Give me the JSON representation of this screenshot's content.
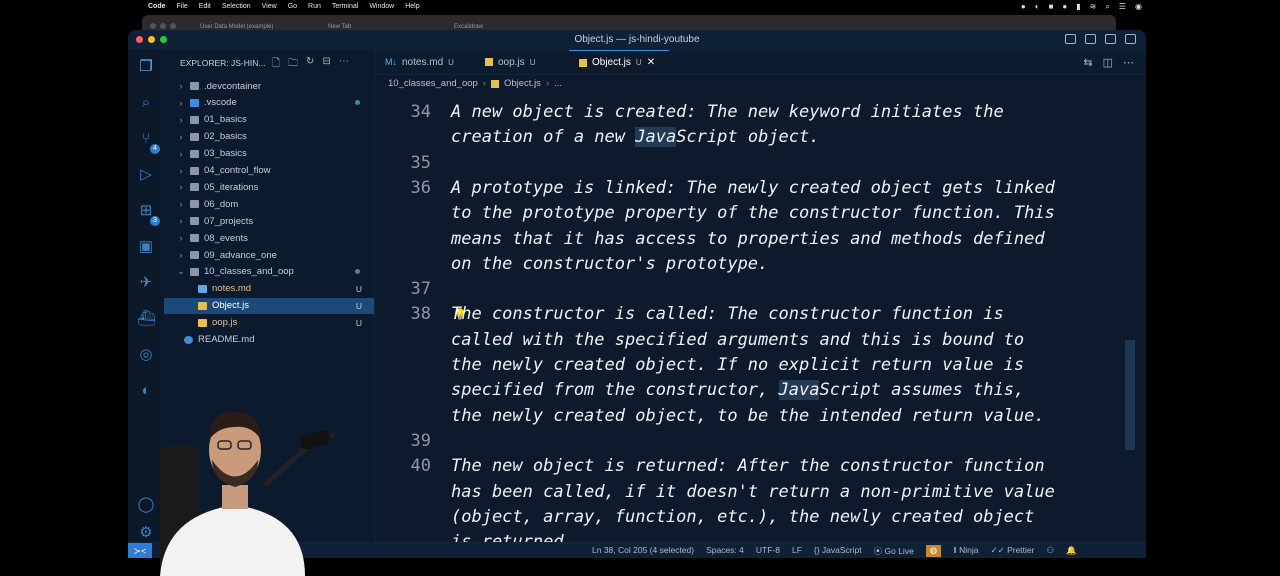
{
  "menubar": {
    "app": "Code",
    "items": [
      "File",
      "Edit",
      "Selection",
      "View",
      "Go",
      "Run",
      "Terminal",
      "Window",
      "Help"
    ]
  },
  "browser_tabs": [
    "User Data Model (example)",
    "New Tab",
    "Excalidraw"
  ],
  "window": {
    "title": "Object.js — js-hindi-youtube"
  },
  "activity_badges": {
    "source_control": "4",
    "extensions": "3"
  },
  "sidebar": {
    "header": "EXPLORER: JS-HIN...",
    "items": [
      {
        "label": ".devcontainer",
        "type": "folder"
      },
      {
        "label": ".vscode",
        "type": "folder",
        "modified": true
      },
      {
        "label": "01_basics",
        "type": "folder"
      },
      {
        "label": "02_basics",
        "type": "folder"
      },
      {
        "label": "03_basics",
        "type": "folder"
      },
      {
        "label": "04_control_flow",
        "type": "folder"
      },
      {
        "label": "05_iterations",
        "type": "folder"
      },
      {
        "label": "06_dom",
        "type": "folder"
      },
      {
        "label": "07_projects",
        "type": "folder"
      },
      {
        "label": "08_events",
        "type": "folder"
      },
      {
        "label": "09_advance_one",
        "type": "folder"
      },
      {
        "label": "10_classes_and_oop",
        "type": "folder-open",
        "modified": true
      },
      {
        "label": "notes.md",
        "type": "file",
        "status": "U"
      },
      {
        "label": "Object.js",
        "type": "file",
        "status": "U",
        "selected": true
      },
      {
        "label": "oop.js",
        "type": "file",
        "status": "U"
      },
      {
        "label": "README.md",
        "type": "file"
      }
    ]
  },
  "tabs": [
    {
      "label": "notes.md",
      "status": "U"
    },
    {
      "label": "oop.js",
      "status": "U"
    },
    {
      "label": "Object.js",
      "status": "U",
      "active": true
    }
  ],
  "breadcrumb": {
    "folder": "10_classes_and_oop",
    "file": "Object.js",
    "more": "..."
  },
  "editor": {
    "lines": [
      {
        "n": "34",
        "text": "A new object is created: The new keyword initiates the"
      },
      {
        "n": "",
        "text": "creation of a new JavaScript object."
      },
      {
        "n": "35",
        "text": ""
      },
      {
        "n": "36",
        "text": "A prototype is linked: The newly created object gets linked"
      },
      {
        "n": "",
        "text": "to the prototype property of the constructor function. This"
      },
      {
        "n": "",
        "text": "means that it has access to properties and methods defined"
      },
      {
        "n": "",
        "text": "on the constructor's prototype."
      },
      {
        "n": "37",
        "text": ""
      },
      {
        "n": "38",
        "text": "The constructor is called: The constructor function is"
      },
      {
        "n": "",
        "text": "called with the specified arguments and this is bound to"
      },
      {
        "n": "",
        "text": "the newly created object. If no explicit return value is"
      },
      {
        "n": "",
        "text": "specified from the constructor, JavaScript assumes this,"
      },
      {
        "n": "",
        "text": "the newly created object, to be the intended return value."
      },
      {
        "n": "39",
        "text": ""
      },
      {
        "n": "40",
        "text": "The new object is returned: After the constructor function"
      },
      {
        "n": "",
        "text": "has been called, if it doesn't return a non-primitive value"
      },
      {
        "n": "",
        "text": "(object, array, function, etc.), the newly created object"
      },
      {
        "n": "",
        "text": "is returned."
      }
    ]
  },
  "statusbar": {
    "position": "Ln 38, Col 205 (4 selected)",
    "spaces": "Spaces: 4",
    "encoding": "UTF-8",
    "eol": "LF",
    "language": "{} JavaScript",
    "golive": "Go Live",
    "ninja": "Ninja",
    "prettier": "Prettier"
  }
}
